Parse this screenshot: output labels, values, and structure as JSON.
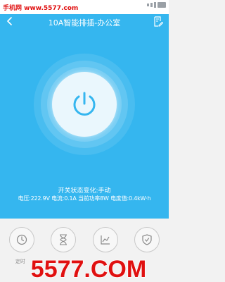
{
  "watermark_top": "手机网 www.5577.com",
  "header": {
    "title": "10A智能排插-办公室"
  },
  "switch_status": "开关状态变化:手动",
  "readings": "电压:222.9V 电流:0.1A 当前功率8W 电度值:0.4kW·h",
  "actions": [
    {
      "icon": "clock-icon",
      "label": "定时"
    },
    {
      "icon": "hourglass-icon",
      "label": ""
    },
    {
      "icon": "chart-icon",
      "label": ""
    },
    {
      "icon": "shield-icon",
      "label": ""
    }
  ],
  "watermark_bottom": "5577.COM",
  "colors": {
    "primary": "#35b6ef",
    "watermark": "#e01010"
  }
}
